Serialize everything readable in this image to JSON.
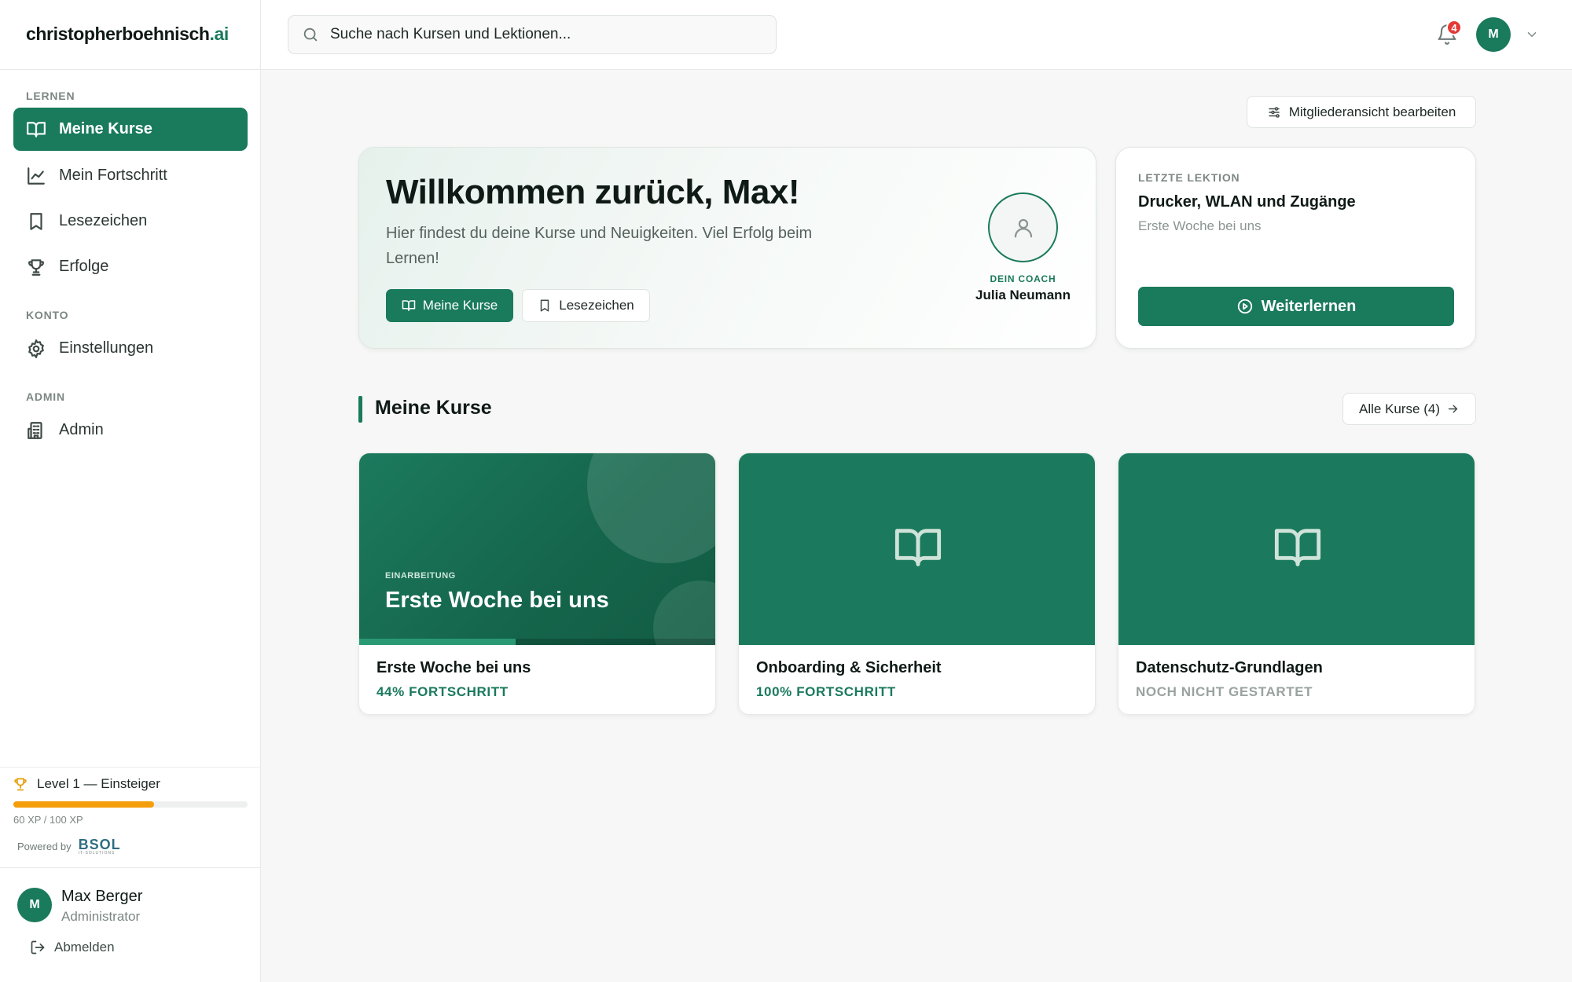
{
  "sidebar": {
    "logo_main": "christopherboehnisch",
    "logo_tld": ".ai",
    "sections": {
      "lernen": "LERNEN",
      "konto": "KONTO",
      "admin": "ADMIN"
    },
    "items": {
      "kurse": "Meine Kurse",
      "fortschritt": "Mein Fortschritt",
      "lesezeichen": "Lesezeichen",
      "erfolge": "Erfolge",
      "einstellungen": "Einstellungen",
      "admin": "Admin"
    },
    "level_label": "Level 1 — Einsteiger",
    "xp_text": "60 XP / 100 XP",
    "xp_fraction": 0.6,
    "powered_by": "Powered by",
    "powered_logo": "BSOL",
    "powered_logo_sub": "IT-SOLUTIONS",
    "user": {
      "initial": "M",
      "name": "Max Berger",
      "role": "Administrator"
    },
    "logout": "Abmelden"
  },
  "topbar": {
    "search_placeholder": "Suche nach Kursen und Lektionen...",
    "notification_count": "4",
    "avatar_initial": "M"
  },
  "main": {
    "edit_view_label": "Mitgliederansicht bearbeiten",
    "welcome": {
      "title": "Willkommen zurück, Max!",
      "text": "Hier findest du deine Kurse und Neuigkeiten. Viel Erfolg beim Lernen!",
      "btn_courses": "Meine Kurse",
      "btn_bookmarks": "Lesezeichen",
      "coach_label": "DEIN COACH",
      "coach_name": "Julia Neumann"
    },
    "last_lesson": {
      "label": "LETZTE LEKTION",
      "title": "Drucker, WLAN und Zugänge",
      "course": "Erste Woche bei uns",
      "button": "Weiterlernen"
    },
    "courses_section": {
      "title": "Meine Kurse",
      "all_button": "Alle Kurse (4)"
    },
    "courses": [
      {
        "cover_kicker": "EINARBEITUNG",
        "cover_title": "Erste Woche bei uns",
        "title": "Erste Woche bei uns",
        "status": "44% FORTSCHRITT",
        "progress": 0.44,
        "status_color": "#1a7a5c"
      },
      {
        "title": "Onboarding & Sicherheit",
        "status": "100% FORTSCHRITT",
        "status_color": "#1a7a5c"
      },
      {
        "title": "Datenschutz-Grundlagen",
        "status": "NOCH NICHT GESTARTET",
        "status_color": "#9aa39f"
      }
    ]
  },
  "colors": {
    "accent": "#1a7a5c",
    "xp_bar": "#f59e0b",
    "badge": "#e53935"
  }
}
